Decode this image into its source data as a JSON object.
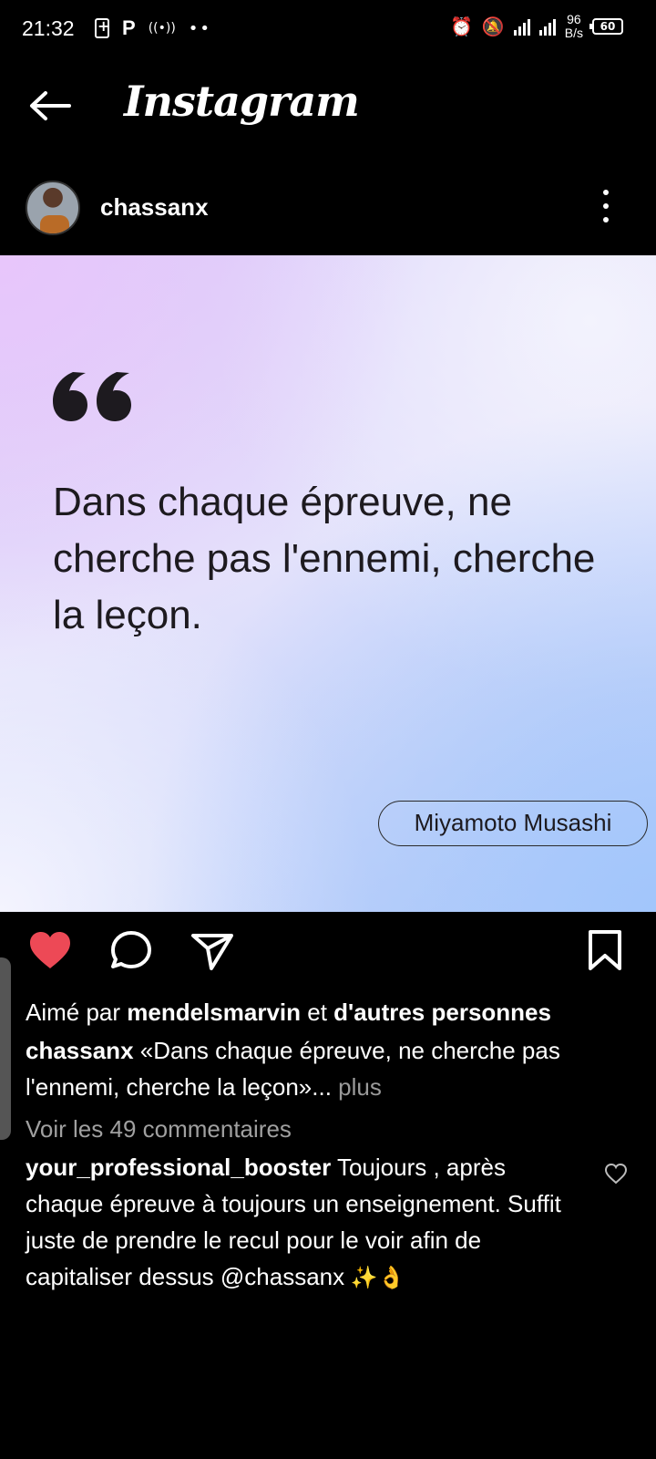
{
  "status_bar": {
    "time": "21:32",
    "left_letter": "P",
    "speed_value": "96",
    "speed_unit": "B/s",
    "battery": "60"
  },
  "header": {
    "title": "Instagram"
  },
  "post": {
    "username": "chassanx",
    "quote": "Dans chaque épreuve, ne cherche pas l'ennemi, cherche la leçon.",
    "author": "Miyamoto Musashi"
  },
  "likes": {
    "prefix": "Aimé par ",
    "user": "mendelsmarvin",
    "middle": " et ",
    "others": "d'autres personnes"
  },
  "caption": {
    "user": "chassanx",
    "text": " «Dans chaque épreuve, ne cherche pas l'ennemi, cherche la leçon»...",
    "more": " plus"
  },
  "view_comments": "Voir les 49 commentaires",
  "comment": {
    "user": "your_professional_booster",
    "text": " Toujours , après chaque épreuve à toujours un enseignement. Suffit juste de prendre le recul pour le voir afin de capitaliser dessus @chassanx",
    "emojis": " ✨👌"
  },
  "colors": {
    "like_red": "#ed4956",
    "background": "#000000"
  }
}
